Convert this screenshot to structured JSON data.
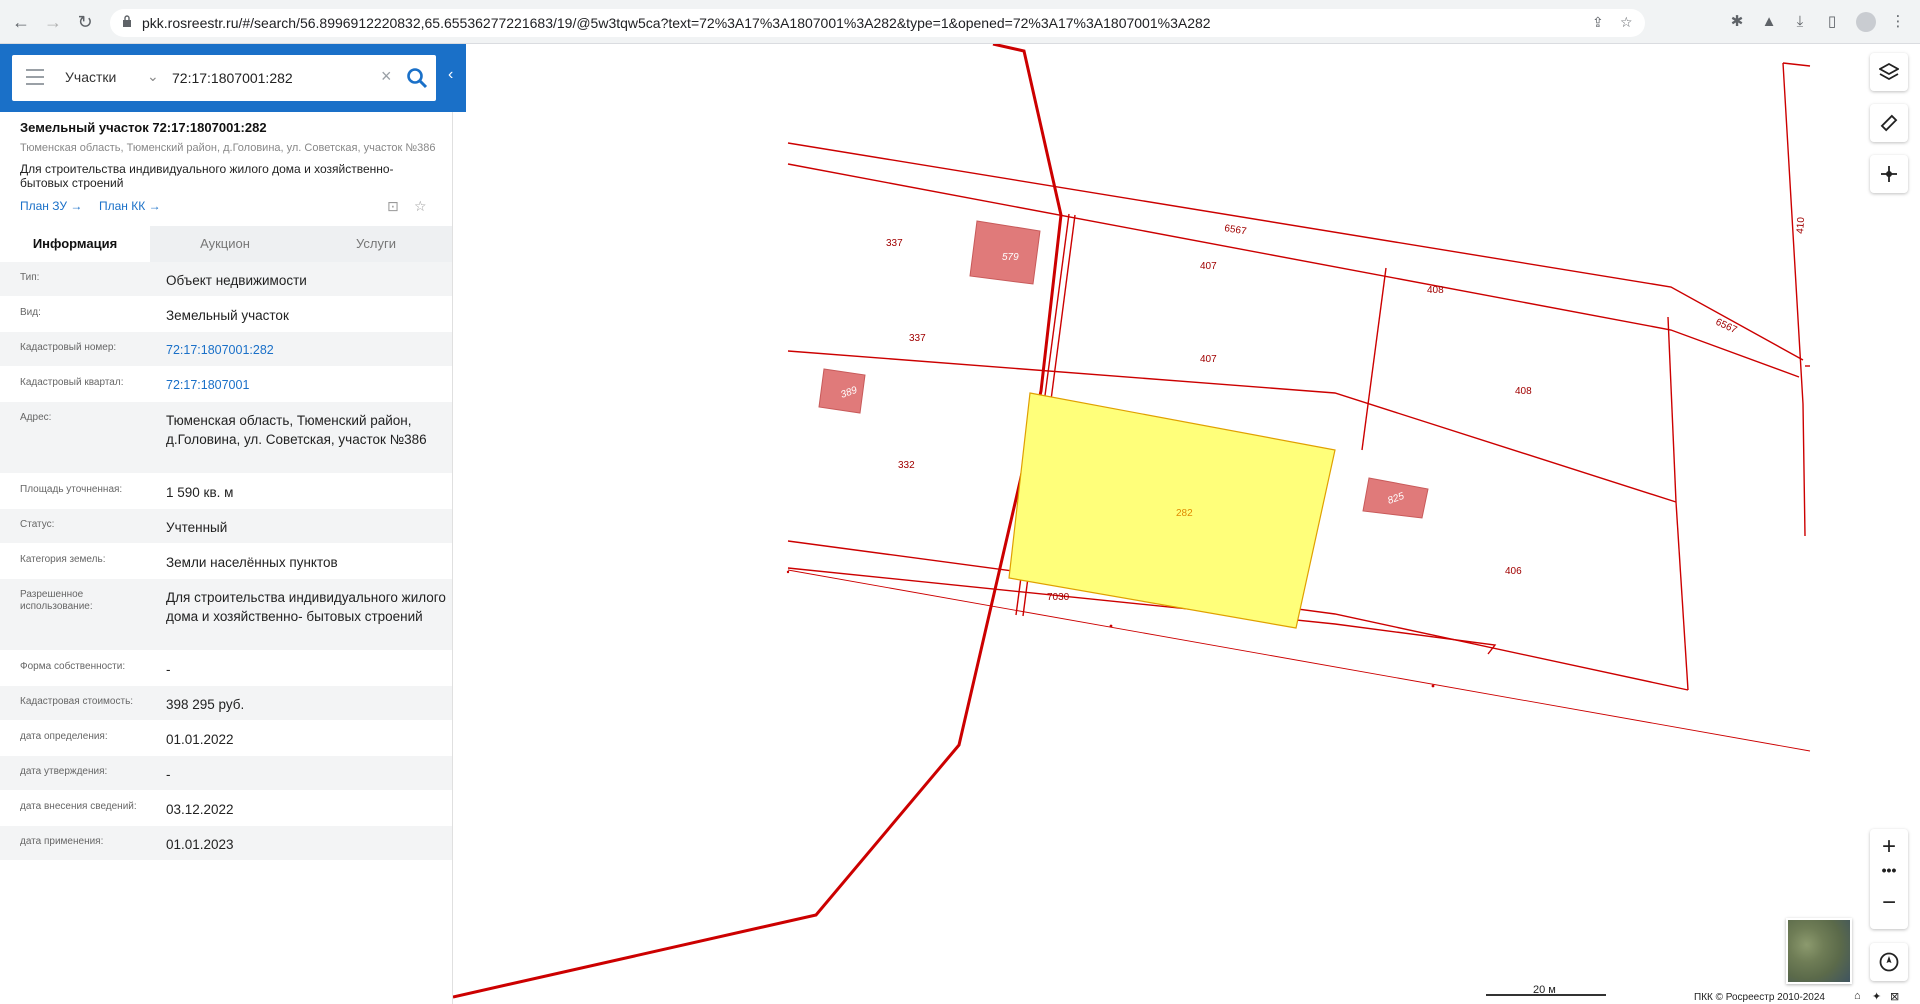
{
  "browser": {
    "url": "pkk.rosreestr.ru/#/search/56.8996912220832,65.65536277221683/19/@5w3tqw5ca?text=72%3A17%3A1807001%3A282&type=1&opened=72%3A17%3A1807001%3A282"
  },
  "search": {
    "type_label": "Участки",
    "value": "72:17:1807001:282"
  },
  "parcel": {
    "title": "Земельный участок 72:17:1807001:282",
    "address_short": "Тюменская область, Тюменский район, д.Головина, ул. Советская, участок №386",
    "description": "Для строительства индивидуального жилого дома и хозяйственно-бытовых строений",
    "plan_zu": "План ЗУ →",
    "plan_kk": "План КК →"
  },
  "tabs": [
    "Информация",
    "Аукцион",
    "Услуги"
  ],
  "info_rows": [
    {
      "key": "Тип:",
      "value": "Объект недвижимости"
    },
    {
      "key": "Вид:",
      "value": "Земельный участок"
    },
    {
      "key": "Кадастровый номер:",
      "value": "72:17:1807001:282"
    },
    {
      "key": "Кадастровый квартал:",
      "value": "72:17:1807001"
    },
    {
      "key": "Адрес:",
      "value": "Тюменская область, Тюменский район, д.Головина, ул. Советская, участок №386"
    },
    {
      "key": "Площадь уточненная:",
      "value": "1 590 кв. м"
    },
    {
      "key": "Статус:",
      "value": "Учтенный"
    },
    {
      "key": "Категория земель:",
      "value": "Земли населённых пунктов"
    },
    {
      "key": "Разрешенное использование:",
      "value": "Для строительства индивидуального жилого дома и хозяйственно- бытовых строений"
    },
    {
      "key": "Форма собственности:",
      "value": "-"
    },
    {
      "key": "Кадастровая стоимость:",
      "value": "398 295 руб."
    },
    {
      "key": "дата определения:",
      "value": "01.01.2022"
    },
    {
      "key": "дата утверждения:",
      "value": "-"
    },
    {
      "key": "дата внесения сведений:",
      "value": "03.12.2022"
    },
    {
      "key": "дата применения:",
      "value": "01.01.2023"
    }
  ],
  "map": {
    "labels": {
      "l337a": "337",
      "l337b": "337",
      "l332": "332",
      "l407a": "407",
      "l407b": "407",
      "l408a": "408",
      "l408b": "408",
      "l406": "406",
      "l282": "282",
      "l6567a": "6567",
      "l6567b": "6567",
      "l7030": "7030",
      "l410": "410",
      "b579": "579",
      "b389": "389",
      "b825": "825"
    },
    "scale": "20 м",
    "copyright": "ПКК © Росреестр 2010-2024",
    "colors": {
      "boundary": "#cc0000",
      "selected_fill": "#ffff7a",
      "building": "#e07a7a"
    }
  }
}
